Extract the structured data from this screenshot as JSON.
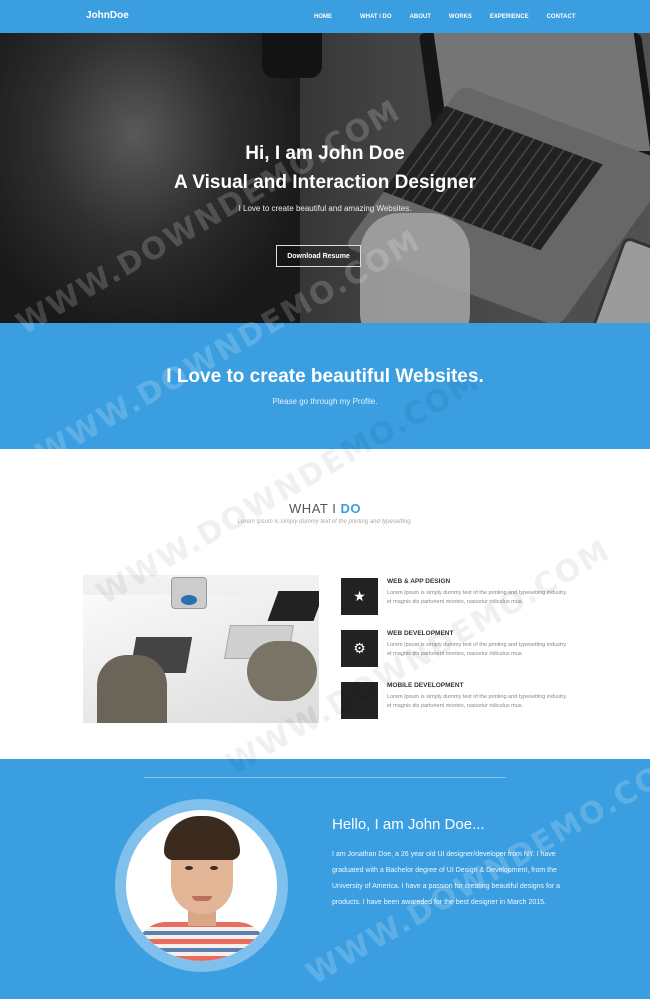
{
  "nav": {
    "brand": "JohnDoe",
    "items": [
      "HOME",
      "WHAT I DO",
      "ABOUT",
      "WORKS",
      "EXPERIENCE",
      "CONTACT"
    ]
  },
  "hero": {
    "line1": "Hi, I am John Doe",
    "line2": "A Visual and Interaction Designer",
    "subtitle": "I Love to create beautiful and amazing Websites.",
    "button": "Download Resume"
  },
  "band": {
    "title": "I Love to create beautiful Websites.",
    "subtitle": "Please go through my Profile."
  },
  "what": {
    "title_plain": "WHAT I",
    "title_highlight": "DO",
    "subtitle": "Lorem Ipsum is simply dummy text of the printing and typesetting.",
    "services": [
      {
        "icon": "star-icon",
        "glyph": "★",
        "title": "WEB & APP DESIGN",
        "desc": "Lorem Ipsum is simply dummy text of the printing and typesetting industry et magnis dis parturient montes, nascetur ridiculus mus."
      },
      {
        "icon": "android-icon",
        "glyph": "⚙",
        "title": "WEB DEVELOPMENT",
        "desc": "Lorem Ipsum is simply dummy text of the printing and typesetting industry et magnis dis parturient montes, nascetur ridiculus mus."
      },
      {
        "icon": "apple-icon",
        "glyph": "",
        "title": "MOBILE DEVELOPMENT",
        "desc": "Lorem Ipsum is simply dummy text of the printing and typesetting industry et magnis dis parturient montes, nascetur ridiculus mus."
      }
    ]
  },
  "about": {
    "title": "Hello, I am John Doe...",
    "text": "I am Jonathan Doe, a 26 year old UI designer/developer from NY. I have graduated with a Bachelor degree of UI Design & Development, from the University of America. I have a passion for creating beautiful designs for a products. I have been awareded for the best designer in March 2015."
  },
  "watermark": "WWW.DOWNDEMO.COM",
  "colors": {
    "accent": "#3a9ee0",
    "dark": "#222222"
  }
}
